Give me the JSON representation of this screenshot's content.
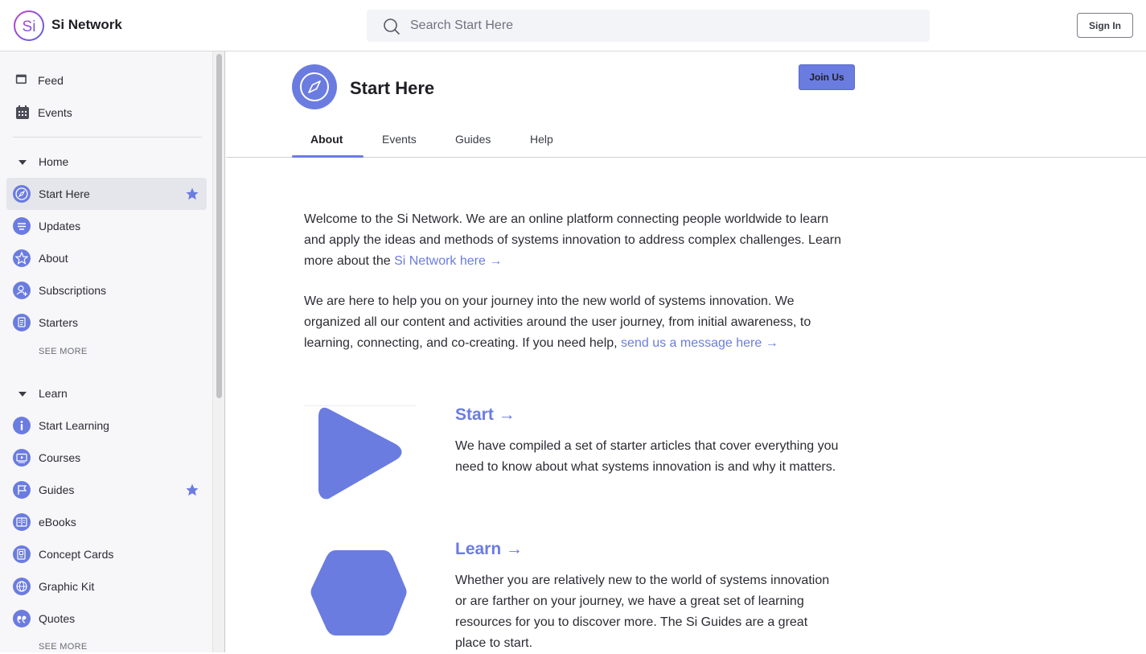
{
  "header": {
    "brand_logo_text": "Si",
    "brand_name": "Si Network",
    "search_placeholder": "Search Start Here",
    "signin_label": "Sign In"
  },
  "sidebar": {
    "top_items": [
      {
        "label": "Feed",
        "icon": "feed-icon"
      },
      {
        "label": "Events",
        "icon": "calendar-icon"
      }
    ],
    "home_section": {
      "title": "Home",
      "items": [
        {
          "label": "Start Here",
          "icon": "compass-icon",
          "active": true,
          "starred": true
        },
        {
          "label": "Updates",
          "icon": "lines-icon"
        },
        {
          "label": "About",
          "icon": "star-outline-icon"
        },
        {
          "label": "Subscriptions",
          "icon": "user-plus-icon"
        },
        {
          "label": "Starters",
          "icon": "document-icon"
        }
      ],
      "see_more": "SEE MORE"
    },
    "learn_section": {
      "title": "Learn",
      "items": [
        {
          "label": "Start Learning",
          "icon": "info-icon"
        },
        {
          "label": "Courses",
          "icon": "video-icon"
        },
        {
          "label": "Guides",
          "icon": "flag-icon",
          "starred": true
        },
        {
          "label": "eBooks",
          "icon": "book-icon"
        },
        {
          "label": "Concept Cards",
          "icon": "cards-icon"
        },
        {
          "label": "Graphic Kit",
          "icon": "globe-icon"
        },
        {
          "label": "Quotes",
          "icon": "quote-icon"
        }
      ],
      "see_more": "SEE MORE"
    }
  },
  "space": {
    "title": "Start Here",
    "join_label": "Join Us",
    "tabs": [
      "About",
      "Events",
      "Guides",
      "Help"
    ],
    "active_tab": "About"
  },
  "content": {
    "intro_p1": "Welcome to the Si Network. We are an online platform connecting people worldwide to learn and apply the ideas and methods of systems innovation to address complex challenges. Learn more about the ",
    "intro_p1_link": "Si Network here →",
    "intro_p2": "We are here to help you on your journey into the new world of systems innovation. We organized all our content and activities around the user journey, from initial awareness, to learning, connecting, and co-creating. If you need help, ",
    "intro_p2_link": "send us a message here →",
    "features": [
      {
        "title": "Start →",
        "text": "We have compiled a set of starter articles that cover everything you need to know about what systems innovation is and why it matters.",
        "image": "play-triangle"
      },
      {
        "title": "Learn →",
        "text": "Whether you are relatively new to the world of systems innovation or are farther on your journey, we have a great set of learning resources for you to discover more. The Si Guides are a great place to start.",
        "image": "hexagon"
      }
    ]
  },
  "colors": {
    "accent": "#6b7ce0",
    "sidebar_bg": "#f7f7f9",
    "active_row": "#e5e6ec"
  }
}
